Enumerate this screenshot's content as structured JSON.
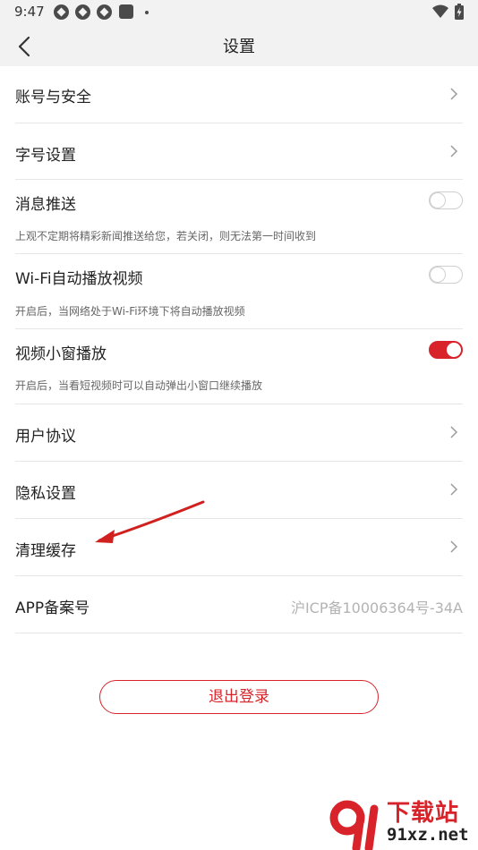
{
  "status_bar": {
    "time": "9:47"
  },
  "header": {
    "title": "设置"
  },
  "settings": [
    {
      "key": "account",
      "label": "账号与安全",
      "type": "link"
    },
    {
      "key": "font",
      "label": "字号设置",
      "type": "link"
    },
    {
      "key": "push",
      "label": "消息推送",
      "type": "toggle",
      "on": false,
      "desc": "上观不定期将精彩新闻推送给您，若关闭，则无法第一时间收到"
    },
    {
      "key": "wifi_autoplay",
      "label": "Wi-Fi自动播放视频",
      "type": "toggle",
      "on": false,
      "desc": "开启后，当网络处于Wi-Fi环境下将自动播放视频"
    },
    {
      "key": "mini_window",
      "label": "视频小窗播放",
      "type": "toggle",
      "on": true,
      "desc": "开启后，当看短视频时可以自动弹出小窗口继续播放"
    },
    {
      "key": "agreement",
      "label": "用户协议",
      "type": "link"
    },
    {
      "key": "privacy",
      "label": "隐私设置",
      "type": "link"
    },
    {
      "key": "cache",
      "label": "清理缓存",
      "type": "link"
    },
    {
      "key": "icp",
      "label": "APP备案号",
      "type": "value",
      "value": "沪ICP备10006364号-34A"
    }
  ],
  "logout": {
    "label": "退出登录"
  },
  "colors": {
    "accent": "#d8232a",
    "divider": "#e6e6e6",
    "header_bg": "#f2f2f2"
  },
  "watermark": {
    "line1": "下载站",
    "line2": "91xz.net"
  }
}
